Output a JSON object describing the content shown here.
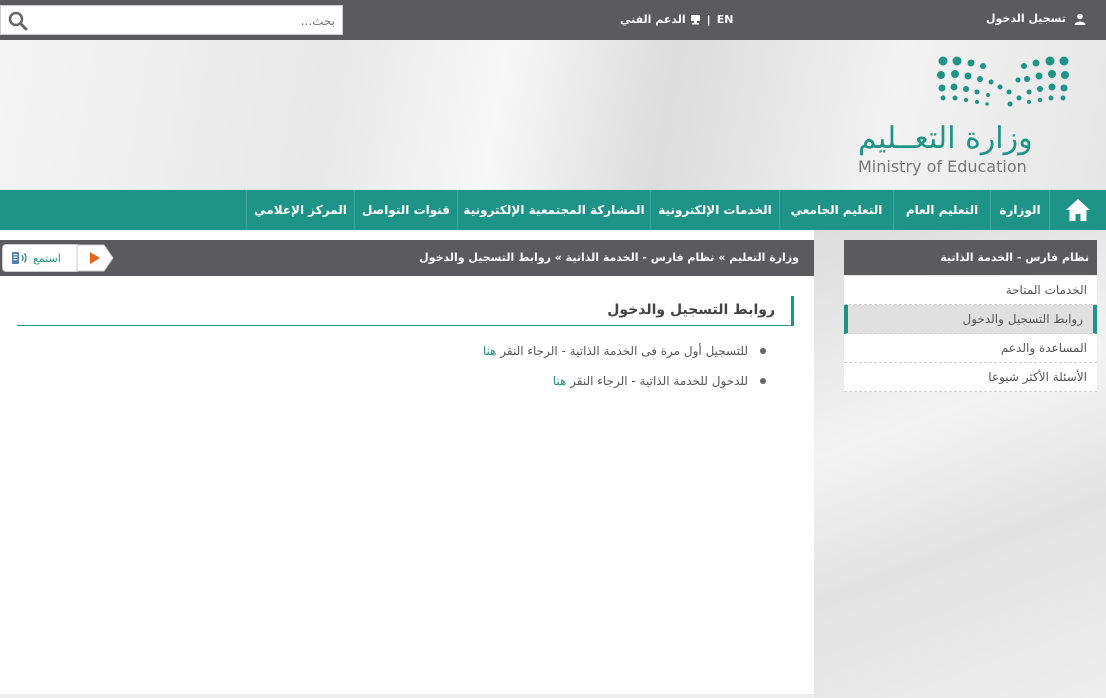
{
  "topbar": {
    "search_placeholder": "بحث...",
    "lang_link": "EN",
    "separator": "|",
    "support_link": "الدعم الفني",
    "login_label": "تسجيل الدخول"
  },
  "header": {
    "logo_ar": "وزارة التعــليم",
    "logo_en": "Ministry of Education",
    "brand_color": "#1e9488"
  },
  "nav": {
    "items": [
      {
        "label": "الوزارة"
      },
      {
        "label": "التعليم العام"
      },
      {
        "label": "التعليم الجامعي"
      },
      {
        "label": "الخدمات الإلكترونية"
      },
      {
        "label": "المشاركة المجتمعية الإلكترونية"
      },
      {
        "label": "قنوات التواصل"
      },
      {
        "label": "المركز الإعلامي"
      }
    ]
  },
  "breadcrumb": {
    "text": "وزارة التعليم » نظام فارس - الخدمة الذاتية » روابط التسجيل والدخول",
    "listen_label": "استمع"
  },
  "sidebar": {
    "title": "نظام فارس - الخدمة الذاتية",
    "items": [
      {
        "label": "الخدمات المتاحة"
      },
      {
        "label": "روابط التسجيل والدخول"
      },
      {
        "label": "المساعدة والدعم"
      },
      {
        "label": "الأسئلة الأكثر شيوعا"
      }
    ]
  },
  "content": {
    "title": "روابط التسجيل والدخول",
    "bullets": [
      {
        "text": "للتسجيل أول مرة فى الخدمة الذاتية - الرجاء النقر ",
        "link": "هنا"
      },
      {
        "text": "للدخول للخدمة الذاتية - الرجاء النقر ",
        "link": "هنا"
      }
    ]
  }
}
